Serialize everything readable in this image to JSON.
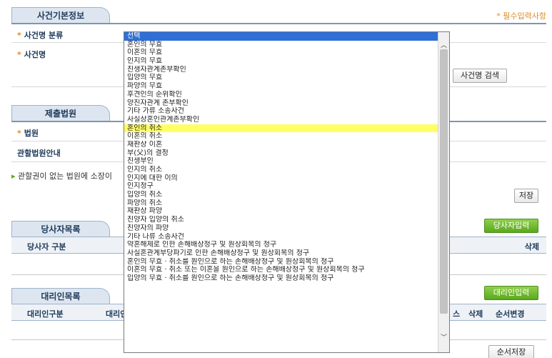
{
  "required_note": "* 필수입력사항",
  "case_info": {
    "title": "사건기본정보",
    "type_label": "사건명 분류",
    "name_label": "사건명",
    "search_button": "사건명 검색"
  },
  "court": {
    "title": "제출법원",
    "court_label": "법원",
    "guide_label": "관할법원안내",
    "note": "관할권이 없는 법원에 소장이"
  },
  "save_button": "저장",
  "parties": {
    "title": "당사자목록",
    "add_button": "당사자입력",
    "col_type": "당사자 구분",
    "col_delete": "삭제"
  },
  "agents": {
    "title": "대리인목록",
    "add_button": "대리인입력",
    "col_type": "대리인구분",
    "col_agent": "대리인",
    "col_s": "스",
    "col_delete": "삭제",
    "col_order": "순서변경"
  },
  "order_save_button": "순서저장",
  "dropdown": {
    "selected": "선택",
    "hovered_index": 14,
    "options": [
      "선택",
      "혼인의 무효",
      "이혼의 무효",
      "인지의 무효",
      "친생자관계존부확인",
      "입양의 무효",
      "파양의 무효",
      "후견인의 순위확인",
      "양친자관계 존부확인",
      "기타 가류 소송사건",
      "사실상혼인관계존부확인",
      "혼인의 취소",
      "이혼의 취소",
      "재판상 이혼",
      "부(父)의 결정",
      "친생부인",
      "인지의 취소",
      "인지에 대한 이의",
      "인지청구",
      "입양의 취소",
      "파양의 취소",
      "재판상 파양",
      "친양자 입양의 취소",
      "친양자의 파양",
      "기타 나류 소송사건",
      "약혼해제로 인한 손해배상청구 및 원상회복의 청구",
      "사실혼관계부당파기로 인한 손해배상청구 및 원상회복의 청구",
      "혼인의 무효 · 취소를 원인으로 하는 손해배상청구 및 원상회복의 청구",
      "이혼의 무효 · 취소 또는 이혼을 원인으로 하는 손해배상청구 및 원상회복의 청구",
      "입양의 무효 · 취소를 원인으로 하는 손해배상청구 및 원상회복의 청구"
    ]
  }
}
